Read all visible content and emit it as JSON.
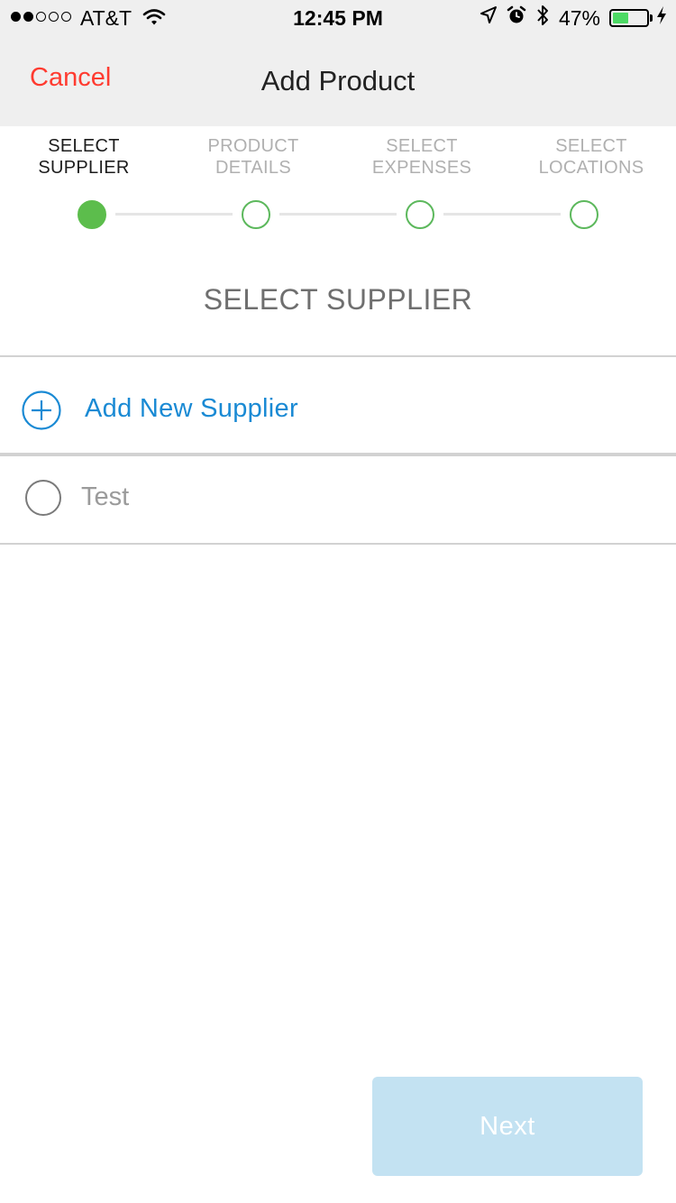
{
  "status_bar": {
    "carrier": "AT&T",
    "time": "12:45 PM",
    "battery_percent": "47%",
    "battery_level": 0.47,
    "signal_bars_filled": 2,
    "signal_bars_total": 5,
    "icons": [
      "wifi-icon",
      "location-arrow-icon",
      "alarm-icon",
      "bluetooth-icon",
      "battery-icon",
      "charging-bolt-icon"
    ]
  },
  "nav": {
    "cancel_label": "Cancel",
    "title": "Add Product"
  },
  "stepper": {
    "steps": [
      {
        "line1": "SELECT",
        "line2": "SUPPLIER",
        "active": true
      },
      {
        "line1": "PRODUCT",
        "line2": "DETAILS",
        "active": false
      },
      {
        "line1": "SELECT",
        "line2": "EXPENSES",
        "active": false
      },
      {
        "line1": "SELECT",
        "line2": "LOCATIONS",
        "active": false
      }
    ]
  },
  "section_title": "SELECT SUPPLIER",
  "add_supplier": {
    "label": "Add New Supplier",
    "icon": "plus-circle-icon"
  },
  "suppliers": [
    {
      "name": "Test",
      "selected": false
    }
  ],
  "next_button": {
    "label": "Next"
  },
  "colors": {
    "cancel": "#ff3b30",
    "accent_blue": "#1a8ad4",
    "step_active": "#5cbd4c",
    "step_outline": "#5cb85c",
    "next_disabled": "#c3e2f2",
    "header_bg": "#efefef"
  }
}
